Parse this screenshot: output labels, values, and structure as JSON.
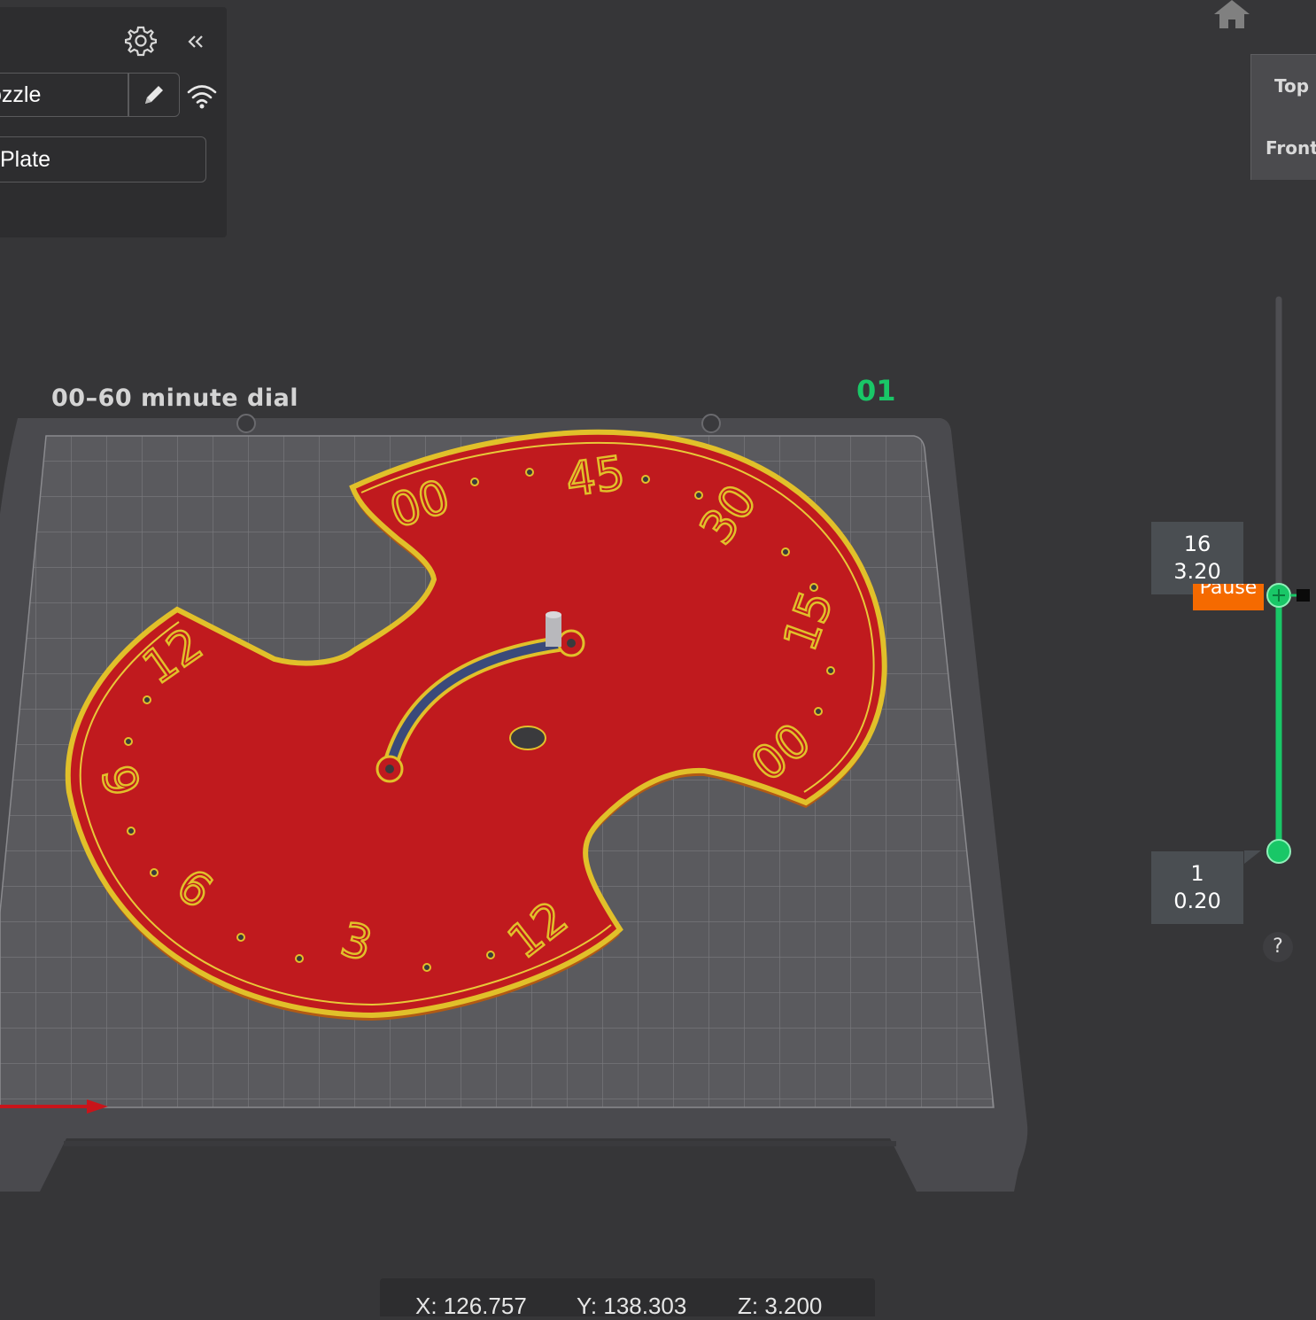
{
  "sidebar": {
    "printer_value": "ozzle",
    "plate_type_value": "Plate",
    "icons": [
      "gear-icon",
      "collapse-icon",
      "pencil-icon",
      "wifi-icon"
    ]
  },
  "view_cube": {
    "items": [
      "Top",
      "Front"
    ]
  },
  "scene": {
    "plate_name": "00–60 minute dial",
    "plate_index": "01",
    "dial_numbers": [
      "00",
      "45",
      "30",
      "15",
      "00",
      "12",
      "9",
      "6",
      "3",
      "12"
    ]
  },
  "layer_slider": {
    "top_layer": "16",
    "top_height": "3.20",
    "bottom_layer": "1",
    "bottom_height": "0.20",
    "pause_label": "Pause",
    "help_label": "?"
  },
  "coords": {
    "x": "X: 126.757",
    "y": "Y: 138.303",
    "z": "Z: 3.200"
  },
  "colors": {
    "accent_green": "#19c767",
    "pause_orange": "#f56a00",
    "model_red": "#c01a1e",
    "model_yellow": "#e1c02a"
  }
}
